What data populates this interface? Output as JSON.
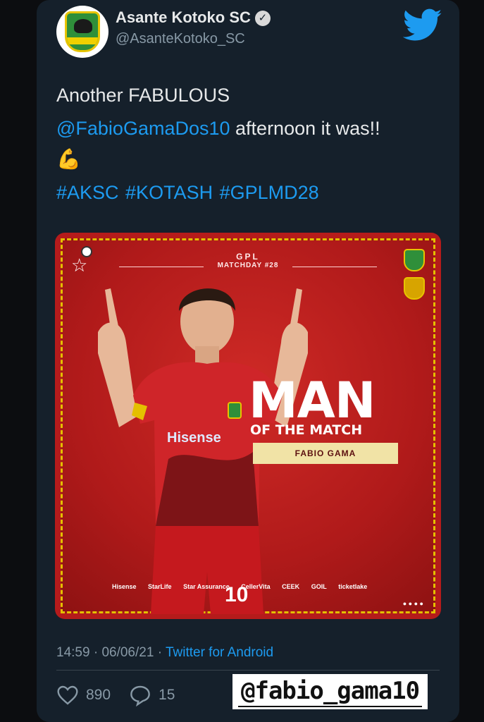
{
  "account": {
    "name": "Asante Kotoko SC",
    "handle": "@AsanteKotoko_SC",
    "verified_icon": "verified-check-icon",
    "logo_icon": "twitter-bird-icon"
  },
  "tweet": {
    "line1": "Another FABULOUS",
    "mention": "@FabioGamaDos10",
    "line2_rest": " afternoon it was!!",
    "emoji": "💪",
    "hashtags": "#AKSC #KOTASH #GPLMD28"
  },
  "media": {
    "league": "GPL",
    "matchday": "MATCHDAY #28",
    "headline": "MAN",
    "subheadline": "OF THE MATCH",
    "player_name": "FABIO GAMA",
    "shirt_sponsor": "Hisense",
    "shirt_number": "10",
    "sponsors": [
      "Hisense",
      "StarLife",
      "Star Assurance",
      "CellerVita",
      "CEEK",
      "GOIL",
      "ticketlake"
    ]
  },
  "meta": {
    "time": "14:59",
    "date": "06/06/21",
    "separator": "·",
    "source": "Twitter for Android"
  },
  "actions": {
    "likes": "890",
    "replies": "15"
  },
  "overlay": {
    "username": "@fabio_gama10"
  },
  "colors": {
    "background": "#15202b",
    "accent": "#1d9bf0",
    "muted": "#8899a6",
    "poster_red": "#b51b1b"
  }
}
